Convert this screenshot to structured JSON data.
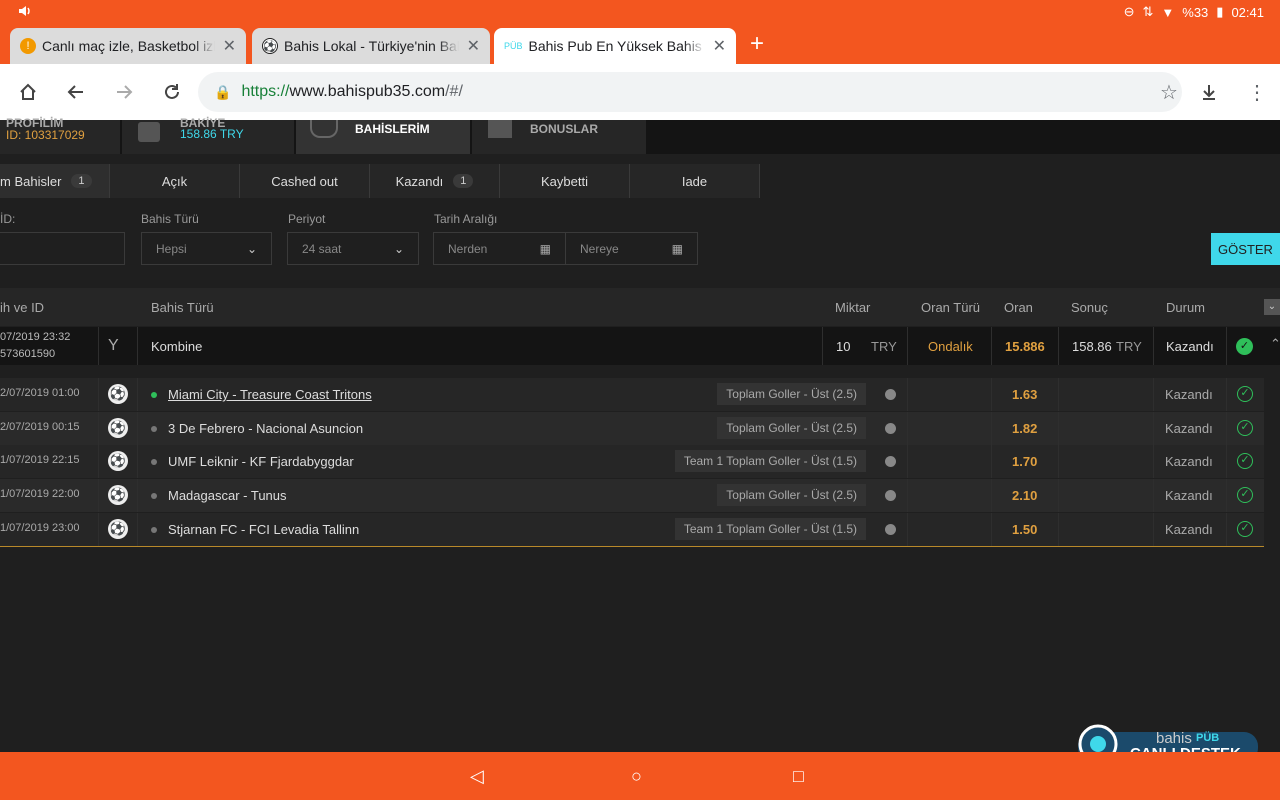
{
  "status_bar": {
    "battery": "%33",
    "time": "02:41"
  },
  "tabs": [
    {
      "title": "Canlı maç izle, Basketbol izle,",
      "icon": "warning-favicon"
    },
    {
      "title": "Bahis Lokal - Türkiye'nin Bahi",
      "icon": "soccer-ball-favicon"
    },
    {
      "title": "Bahis Pub En Yüksek Bahis O",
      "icon": "pub-favicon",
      "icon_text": "PÜB"
    }
  ],
  "url": {
    "protocol": "https://",
    "host": "www.bahispub35.com",
    "path": "/#/"
  },
  "site_nav": {
    "profile_label": "PROFİLİM",
    "profile_id": "ID: 103317029",
    "balance_label": "BAKİYE",
    "balance_value": "158.86 TRY",
    "bets_label": "BAHİSLERİM",
    "bonus_label": "BONUSLAR"
  },
  "filter_tabs": [
    {
      "label": "m Bahisler",
      "badge": "1"
    },
    {
      "label": "Açık"
    },
    {
      "label": "Cashed out"
    },
    {
      "label": "Kazandı",
      "badge": "1"
    },
    {
      "label": "Kaybetti"
    },
    {
      "label": "Iade"
    }
  ],
  "filters": {
    "id_label": "İD:",
    "bet_type_label": "Bahis Türü",
    "bet_type_value": "Hepsi",
    "period_label": "Periyot",
    "period_value": "24 saat",
    "date_range_label": "Tarih Aralığı",
    "from_placeholder": "Nerden",
    "to_placeholder": "Nereye",
    "show_button": "GÖSTER"
  },
  "table_headers": {
    "date_id": "ih ve ID",
    "bet_type": "Bahis Türü",
    "amount": "Miktar",
    "odds_type": "Oran Türü",
    "odds": "Oran",
    "result": "Sonuç",
    "status": "Durum"
  },
  "main_bet": {
    "date": "07/2019 23:32",
    "id": "573601590",
    "type": "Kombine",
    "amount": "10",
    "currency": "TRY",
    "odds_type": "Ondalık",
    "odds": "15.886",
    "result": "158.86",
    "result_currency": "TRY",
    "status": "Kazandı"
  },
  "selections": [
    {
      "date": "2/07/2019 01:00",
      "match": "Miami City - Treasure Coast Tritons",
      "market": "Toplam Goller - Üst (2.5)",
      "odds": "1.63",
      "status": "Kazandı",
      "live": true
    },
    {
      "date": "2/07/2019 00:15",
      "match": "3 De Febrero - Nacional Asuncion",
      "market": "Toplam Goller - Üst (2.5)",
      "odds": "1.82",
      "status": "Kazandı",
      "live": false
    },
    {
      "date": "1/07/2019 22:15",
      "match": "UMF Leiknir - KF Fjardabyggdar",
      "market": "Team 1 Toplam Goller - Üst (1.5)",
      "odds": "1.70",
      "status": "Kazandı",
      "live": false
    },
    {
      "date": "1/07/2019 22:00",
      "match": "Madagascar - Tunus",
      "market": "Toplam Goller - Üst (2.5)",
      "odds": "2.10",
      "status": "Kazandı",
      "live": false
    },
    {
      "date": "1/07/2019 23:00",
      "match": "Stjarnan FC - FCI Levadia Tallinn",
      "market": "Team 1 Toplam Goller - Üst (1.5)",
      "odds": "1.50",
      "status": "Kazandı",
      "live": false
    }
  ],
  "live_support": {
    "brand": "bahis",
    "brand_accent": "PÜB",
    "label": "CANLI DESTEK"
  },
  "colors": {
    "accent": "#f3561f",
    "gold": "#e0a040",
    "success": "#2fbf5a",
    "button": "#3fd8ea"
  }
}
